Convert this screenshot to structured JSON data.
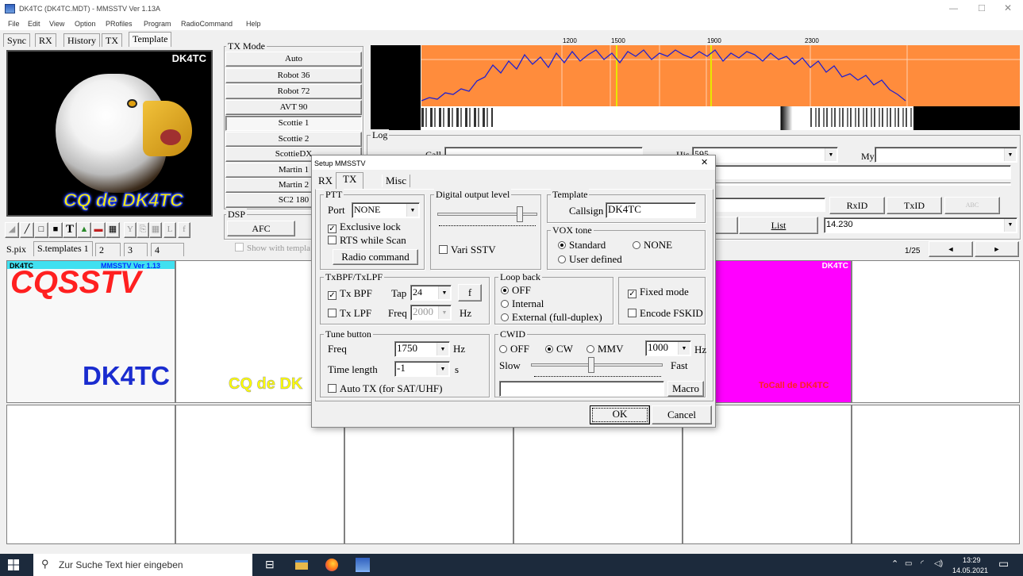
{
  "window": {
    "title": "DK4TC (DK4TC.MDT) - MMSSTV Ver 1.13A",
    "minimize": "—",
    "maximize": "□",
    "close": "✕"
  },
  "menu": [
    "File",
    "Edit",
    "View",
    "Option",
    "PRofiles",
    "Program",
    "RadioCommand",
    "Help"
  ],
  "left_tabs": [
    "Sync",
    "RX",
    "History",
    "TX",
    "Template"
  ],
  "preview": {
    "callsign": "DK4TC",
    "cq_text": "CQ de DK4TC"
  },
  "tx_mode": {
    "title": "TX Mode",
    "modes": [
      "Auto",
      "Robot 36",
      "Robot 72",
      "AVT 90",
      "Scottie 1",
      "Scottie 2",
      "ScottieDX",
      "Martin 1",
      "Martin 2",
      "SC2 180"
    ]
  },
  "dsp": {
    "title": "DSP",
    "afc": "AFC",
    "show_template": "Show with templa"
  },
  "toolbar_icons": {
    "tiny1": "L",
    "tiny2": "f",
    "small1": "Y"
  },
  "spectrum": {
    "scale": [
      "1200",
      "1500",
      "1900",
      "2300"
    ]
  },
  "log": {
    "title": "Log",
    "call_label": "Call",
    "his_label": "His",
    "his_value": "595",
    "my_label": "My",
    "rxid": "RxID",
    "txid": "TxID",
    "list": "List",
    "freq": "14.230",
    "page": "1/25",
    "prev": "◄",
    "next": "►"
  },
  "template_tabs": [
    "S.pix",
    "S.templates 1",
    "2",
    "3",
    "4"
  ],
  "templates": {
    "t1_head": "DK4TC",
    "t1_ver": "MMSSTV Ver 1.13",
    "t1_big": "CQSSTV",
    "t1_call": "DK4TC",
    "t2_text": "CQ de DK",
    "t5_head": "DK4TC",
    "t5_text": "ToCall de DK4TC"
  },
  "dialog": {
    "title": "Setup MMSSTV",
    "close": "✕",
    "tabs": [
      "RX",
      "TX",
      "Misc"
    ],
    "ptt": {
      "title": "PTT",
      "port_label": "Port",
      "port_value": "NONE",
      "exclusive": "Exclusive lock",
      "rts": "RTS while Scan",
      "radio_cmd": "Radio command"
    },
    "digital": {
      "title": "Digital output level",
      "vari": "Vari SSTV"
    },
    "template": {
      "title": "Template",
      "callsign_label": "Callsign",
      "callsign_value": "DK4TC"
    },
    "vox": {
      "title": "VOX tone",
      "standard": "Standard",
      "none": "NONE",
      "user": "User defined"
    },
    "bpf": {
      "title": "TxBPF/TxLPF",
      "txbpf": "Tx BPF",
      "tap_label": "Tap",
      "tap_value": "24",
      "f_btn": "f",
      "txlpf": "Tx LPF",
      "freq_label": "Freq",
      "freq_value": "2000",
      "hz": "Hz"
    },
    "loop": {
      "title": "Loop back",
      "off": "OFF",
      "internal": "Internal",
      "external": "External (full-duplex)"
    },
    "fixed": "Fixed mode",
    "fskid": "Encode FSKID",
    "tune": {
      "title": "Tune button",
      "freq_label": "Freq",
      "freq_value": "1750",
      "hz": "Hz",
      "time_label": "Time length",
      "time_value": "-1",
      "s": "s",
      "auto": "Auto TX (for SAT/UHF)"
    },
    "cwid": {
      "title": "CWID",
      "off": "OFF",
      "cw": "CW",
      "mmv": "MMV",
      "rate": "1000",
      "hz": "Hz",
      "slow": "Slow",
      "fast": "Fast",
      "macro": "Macro"
    },
    "ok": "OK",
    "cancel": "Cancel"
  },
  "taskbar": {
    "search": "Zur Suche Text hier eingeben",
    "time": "13:29",
    "date": "14.05.2021"
  },
  "colors": {
    "orange": "#ff8c3c",
    "magenta": "#ff00ff",
    "red": "#ff2020",
    "blue": "#1a2ccf",
    "yellow": "#ffff00",
    "taskbar": "#1c2a3c"
  }
}
